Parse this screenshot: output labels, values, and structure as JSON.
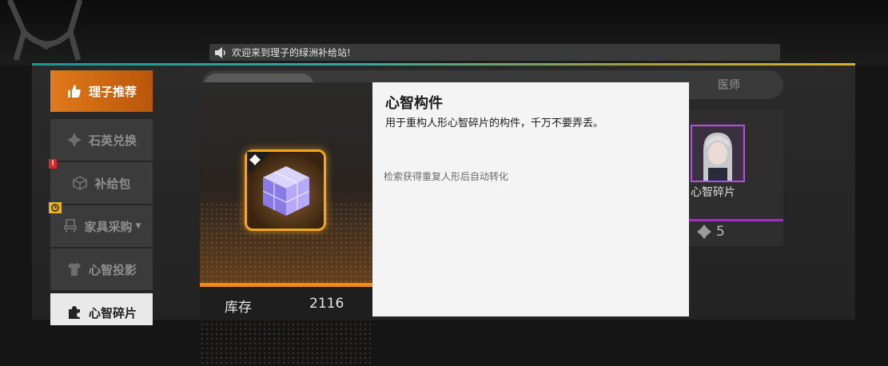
{
  "announcement": {
    "icon": "speaker-icon",
    "text": "欢迎来到理子的绿洲补给站!"
  },
  "sidebar": {
    "items": [
      {
        "label": "理子推荐",
        "icon": "thumbs-up-icon",
        "state": "active"
      },
      {
        "label": "石英兑换",
        "icon": "quartz-icon",
        "state": "normal"
      },
      {
        "label": "补给包",
        "icon": "box-icon",
        "state": "normal",
        "badge": "!"
      },
      {
        "label": "家具采购",
        "icon": "chair-icon",
        "state": "normal",
        "badge_icon": "clock-icon",
        "has_dropdown": true
      },
      {
        "label": "心智投影",
        "icon": "shirt-icon",
        "state": "normal"
      },
      {
        "label": "心智碎片",
        "icon": "puzzle-icon",
        "state": "selected"
      }
    ]
  },
  "tabs": [
    {
      "label": ""
    },
    {
      "label": "医师"
    }
  ],
  "shop_card": {
    "name": "心智碎片",
    "price": "5",
    "currency_icon": "diamond-icon"
  },
  "popup": {
    "item_icon": "mind-cube-icon",
    "title": "心智构件",
    "description": "用于重构人形心智碎片的构件，千万不要弄丢。",
    "note": "检索获得重复人形后自动转化",
    "stock_label": "库存",
    "stock_value": "2116"
  },
  "colors": {
    "accent_orange": "#e07a1a",
    "frame_gold": "#f2a81a",
    "rarity_purple": "#b54fe0"
  }
}
